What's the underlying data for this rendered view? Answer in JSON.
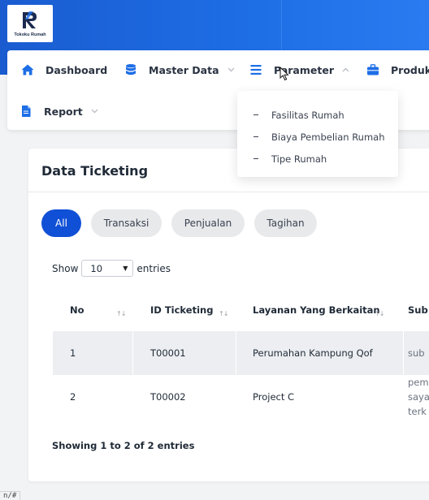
{
  "brand": {
    "logo_text": "Tokoku Rumah"
  },
  "nav": {
    "items": [
      {
        "label": "Dashboard",
        "icon": "home-icon"
      },
      {
        "label": "Master Data",
        "icon": "database-icon"
      },
      {
        "label": "Parameter",
        "icon": "list-icon"
      },
      {
        "label": "Produk",
        "icon": "briefcase-icon"
      },
      {
        "label": "Report",
        "icon": "file-icon"
      }
    ],
    "dropdown": {
      "items": [
        {
          "label": "Fasilitas Rumah"
        },
        {
          "label": "Biaya Pembelian Rumah"
        },
        {
          "label": "Tipe Rumah"
        }
      ]
    }
  },
  "card": {
    "title": "Data Ticketing",
    "filters": [
      {
        "label": "All",
        "active": true
      },
      {
        "label": "Transaksi"
      },
      {
        "label": "Penjualan"
      },
      {
        "label": "Tagihan"
      }
    ],
    "show": {
      "prefix": "Show",
      "value": "10",
      "suffix": "entries"
    },
    "table": {
      "columns": [
        "No",
        "ID Ticketing",
        "Layanan Yang Berkaitan",
        "Sub"
      ],
      "rows": [
        {
          "no": "1",
          "id": "T00001",
          "layanan": "Perumahan Kampung Qof",
          "sub": [
            "sub"
          ]
        },
        {
          "no": "2",
          "id": "T00002",
          "layanan": "Project C",
          "sub": [
            "pem",
            "saya",
            "terk"
          ]
        }
      ]
    },
    "info": "Showing 1 to 2 of 2 entries"
  },
  "status_url": "n/#",
  "colors": {
    "primary": "#1050d6",
    "topbar": "#1e6ee6"
  }
}
